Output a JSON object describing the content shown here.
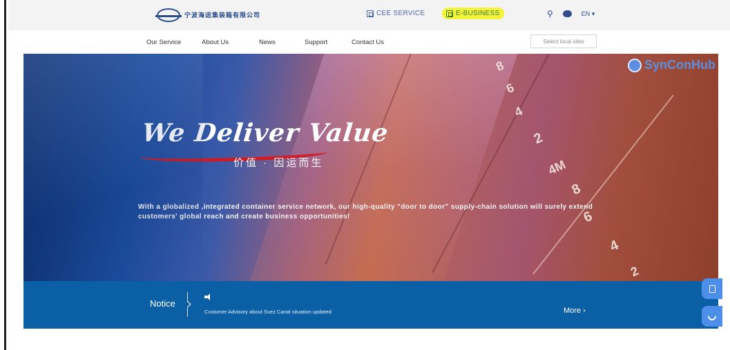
{
  "header": {
    "logo_cn": "宁波海运集装箱有限公司",
    "logo_en": "",
    "services": [
      {
        "label": "CEE SERVICE",
        "icon": "service-box-icon"
      },
      {
        "label": "E-BUSINESS",
        "icon": "service-box-icon",
        "highlight": "#f3f33a"
      }
    ],
    "icons": [
      "search-icon",
      "chat-icon"
    ],
    "language": "EN"
  },
  "nav": {
    "items": [
      "Our Service",
      "About Us",
      "News",
      "Support",
      "Contact Us"
    ],
    "site_select": "Select local sites"
  },
  "hero": {
    "brand": "SynConHub",
    "headline": "We Deliver Value",
    "tagline_cn": "价值 · 因运而生",
    "description": "With a globalized ,integrated container service network, our high-quality \"door to door\" supply-chain solution will surely extend customers' global reach and create business opportunities!",
    "hull_marks": [
      "8",
      "6",
      "4",
      "2",
      "4M",
      "8",
      "6",
      "4",
      "2"
    ]
  },
  "notice": {
    "title": "Notice",
    "text": "Customer Advisory about Suez Canal situation updated",
    "more": "More",
    "more_arrow": "›"
  },
  "floating": {
    "buttons": [
      "document-icon",
      "phone-icon"
    ]
  },
  "colors": {
    "nav_blue": "#2a4c8c",
    "notice_bar": "#0b5fa5",
    "highlight": "#f3f33a",
    "accent_red": "#d21a22",
    "float_blue": "#4d8fe8"
  }
}
